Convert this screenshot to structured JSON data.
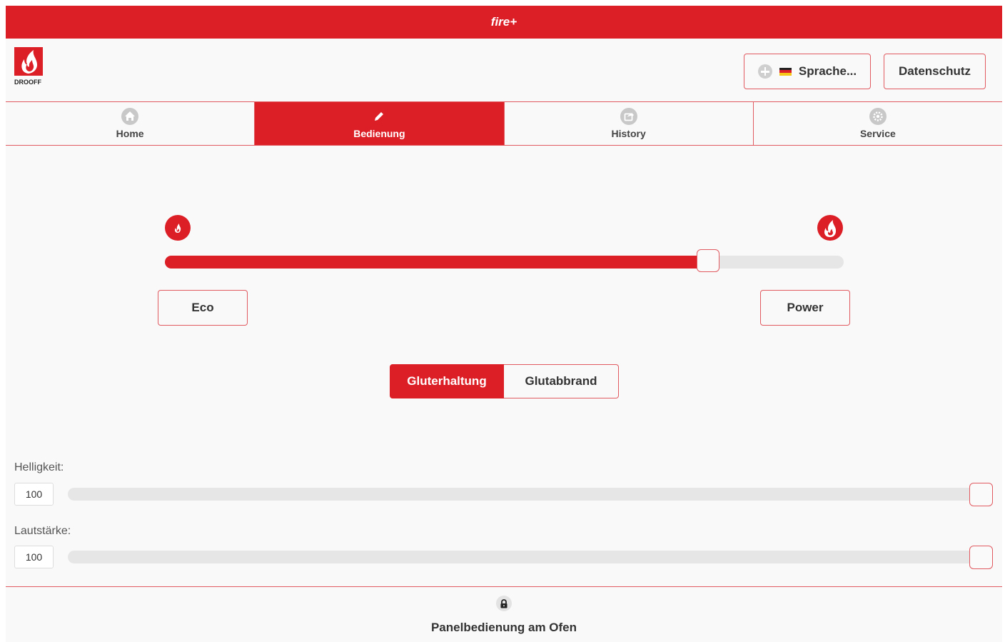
{
  "app": {
    "title": "fire+"
  },
  "header": {
    "logo_text": "DROOFF",
    "language_button": {
      "label": "Sprache...",
      "flag": "de-flag-icon"
    },
    "privacy_button": {
      "label": "Datenschutz"
    }
  },
  "tabs": [
    {
      "label": "Home",
      "icon": "home-icon",
      "active": false
    },
    {
      "label": "Bedienung",
      "icon": "pencil-icon",
      "active": true
    },
    {
      "label": "History",
      "icon": "share-icon",
      "active": false
    },
    {
      "label": "Service",
      "icon": "gear-icon",
      "active": false
    }
  ],
  "power_control": {
    "left_icon": "small-flame-icon",
    "right_icon": "large-flame-icon",
    "level_fraction": 0.8,
    "eco_label": "Eco",
    "power_label": "Power"
  },
  "mode_toggle": {
    "options": [
      "Gluterhaltung",
      "Glutabbrand"
    ],
    "selected": "Gluterhaltung"
  },
  "settings": {
    "brightness": {
      "label": "Helligkeit:",
      "value": "100",
      "level_fraction": 1.0
    },
    "volume": {
      "label": "Lautstärke:",
      "value": "100",
      "level_fraction": 1.0
    }
  },
  "footer": {
    "icon": "lock-icon",
    "text": "Panelbedienung am Ofen"
  },
  "colors": {
    "accent": "#dc1e26",
    "border": "#e05a60",
    "track": "#e6e6e6",
    "background": "#f9f9f9"
  }
}
